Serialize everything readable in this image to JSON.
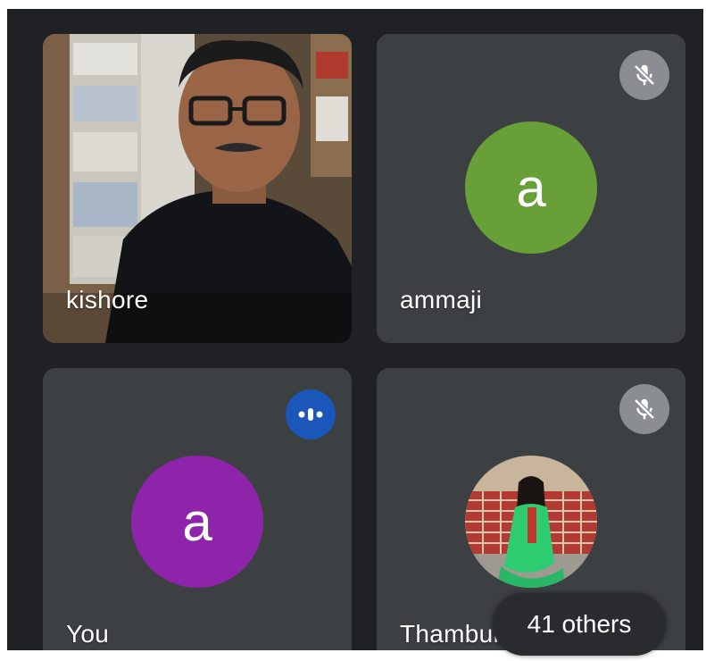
{
  "participants": [
    {
      "name": "kishore",
      "type": "video"
    },
    {
      "name": "ammaji",
      "type": "avatar",
      "initial": "a",
      "avatar_color": "#689f38",
      "muted": true
    },
    {
      "name": "You",
      "type": "avatar",
      "initial": "a",
      "avatar_color": "#8e24aa",
      "speaking": true
    },
    {
      "name": "Thambur",
      "type": "photo",
      "muted": true
    }
  ],
  "overflow": {
    "label": "41 others"
  },
  "icons": {
    "muted": "mic-off-icon",
    "speaking": "speaking-indicator-icon"
  },
  "colors": {
    "background": "#202124",
    "tile": "#3c4043",
    "mute_badge": "#8a8d91",
    "speaking_badge": "#1a57b8"
  }
}
